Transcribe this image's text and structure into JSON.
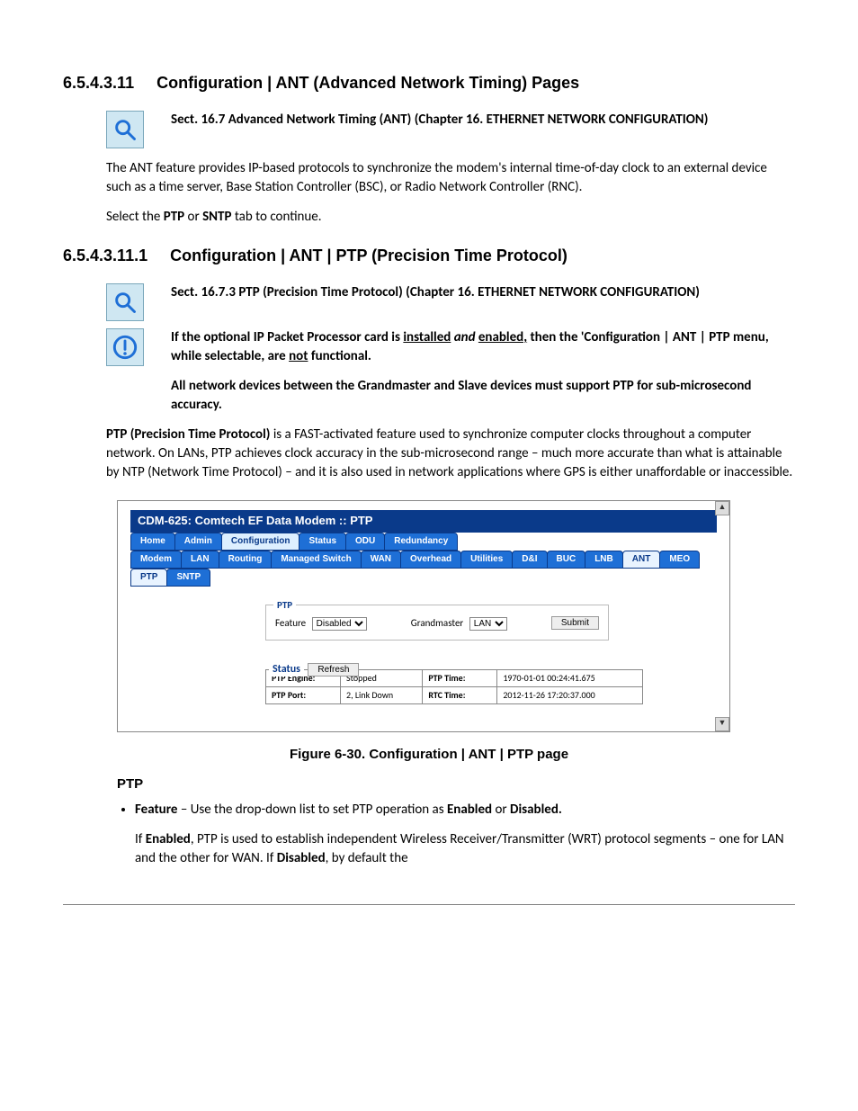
{
  "h1": {
    "num": "6.5.4.3.11",
    "title": "Configuration | ANT (Advanced Network Timing) Pages"
  },
  "ref1": "Sect. 16.7 Advanced Network Timing (ANT) (Chapter 16. ETHERNET NETWORK CONFIGURATION)",
  "p1": "The ANT feature provides IP-based protocols to synchronize the modem's internal time-of-day clock to an external device such as a time server, Base Station Controller (BSC), or Radio Network Controller (RNC).",
  "p2a": "Select the ",
  "p2b": "PTP",
  "p2c": " or ",
  "p2d": "SNTP",
  "p2e": " tab to continue.",
  "h2": {
    "num": "6.5.4.3.11.1",
    "title": "Configuration | ANT | PTP (Precision Time Protocol)"
  },
  "ref2": "Sect. 16.7.3 PTP (Precision Time Protocol) (Chapter 16. ETHERNET NETWORK CONFIGURATION)",
  "warn1a": "If the optional IP Packet Processor card is ",
  "warn1b": "installed",
  "warn1c": " and ",
  "warn1d": "enabled,",
  "warn1e": " then the 'Configuration | ANT | PTP menu, while selectable, are ",
  "warn1f": "not",
  "warn1g": " functional.",
  "warn2": "All network devices between the Grandmaster and Slave devices must support PTP for sub-microsecond accuracy.",
  "p3a": "PTP (Precision Time Protocol)",
  "p3b": " is a FAST-activated feature used to synchronize computer clocks throughout a computer network. On LANs, PTP achieves clock accuracy in the sub-microsecond range – much more accurate than what is attainable by NTP (Network Time Protocol) – and it is also used in network applications where GPS is either unaffordable or inaccessible.",
  "shot": {
    "title": "CDM-625: Comtech EF Data Modem :: PTP",
    "tabs1": [
      "Home",
      "Admin",
      "Configuration",
      "Status",
      "ODU",
      "Redundancy"
    ],
    "tabs1_sel": 2,
    "tabs2": [
      "Modem",
      "LAN",
      "Routing",
      "Managed Switch",
      "WAN",
      "Overhead",
      "Utilities",
      "D&I",
      "BUC",
      "LNB",
      "ANT",
      "MEO"
    ],
    "tabs2_sel": 10,
    "tabs3": [
      "PTP",
      "SNTP"
    ],
    "tabs3_sel": 0,
    "ptp": {
      "legend": "PTP",
      "feature_label": "Feature",
      "feature_value": "Disabled",
      "gm_label": "Grandmaster",
      "gm_value": "LAN",
      "submit": "Submit"
    },
    "status": {
      "legend": "Status",
      "refresh": "Refresh",
      "rows": [
        {
          "l1": "PTP Engine:",
          "v1": "Stopped",
          "l2": "PTP Time:",
          "v2": "1970-01-01 00:24:41.675"
        },
        {
          "l1": "PTP Port:",
          "v1": "2, Link Down",
          "l2": "RTC Time:",
          "v2": "2012-11-26 17:20:37.000"
        }
      ]
    }
  },
  "figcap": "Figure 6-30. Configuration | ANT | PTP page",
  "h3": "PTP",
  "bullet_a": "Feature",
  "bullet_b": " – Use the drop-down list to set PTP operation as ",
  "bullet_c": "Enabled",
  "bullet_d": " or ",
  "bullet_e": "Disabled.",
  "p4a": "If ",
  "p4b": "Enabled",
  "p4c": ", PTP is used to establish independent Wireless Receiver/Transmitter (WRT) protocol segments – one for LAN and the other for WAN. If ",
  "p4d": "Disabled",
  "p4e": ", by default the"
}
